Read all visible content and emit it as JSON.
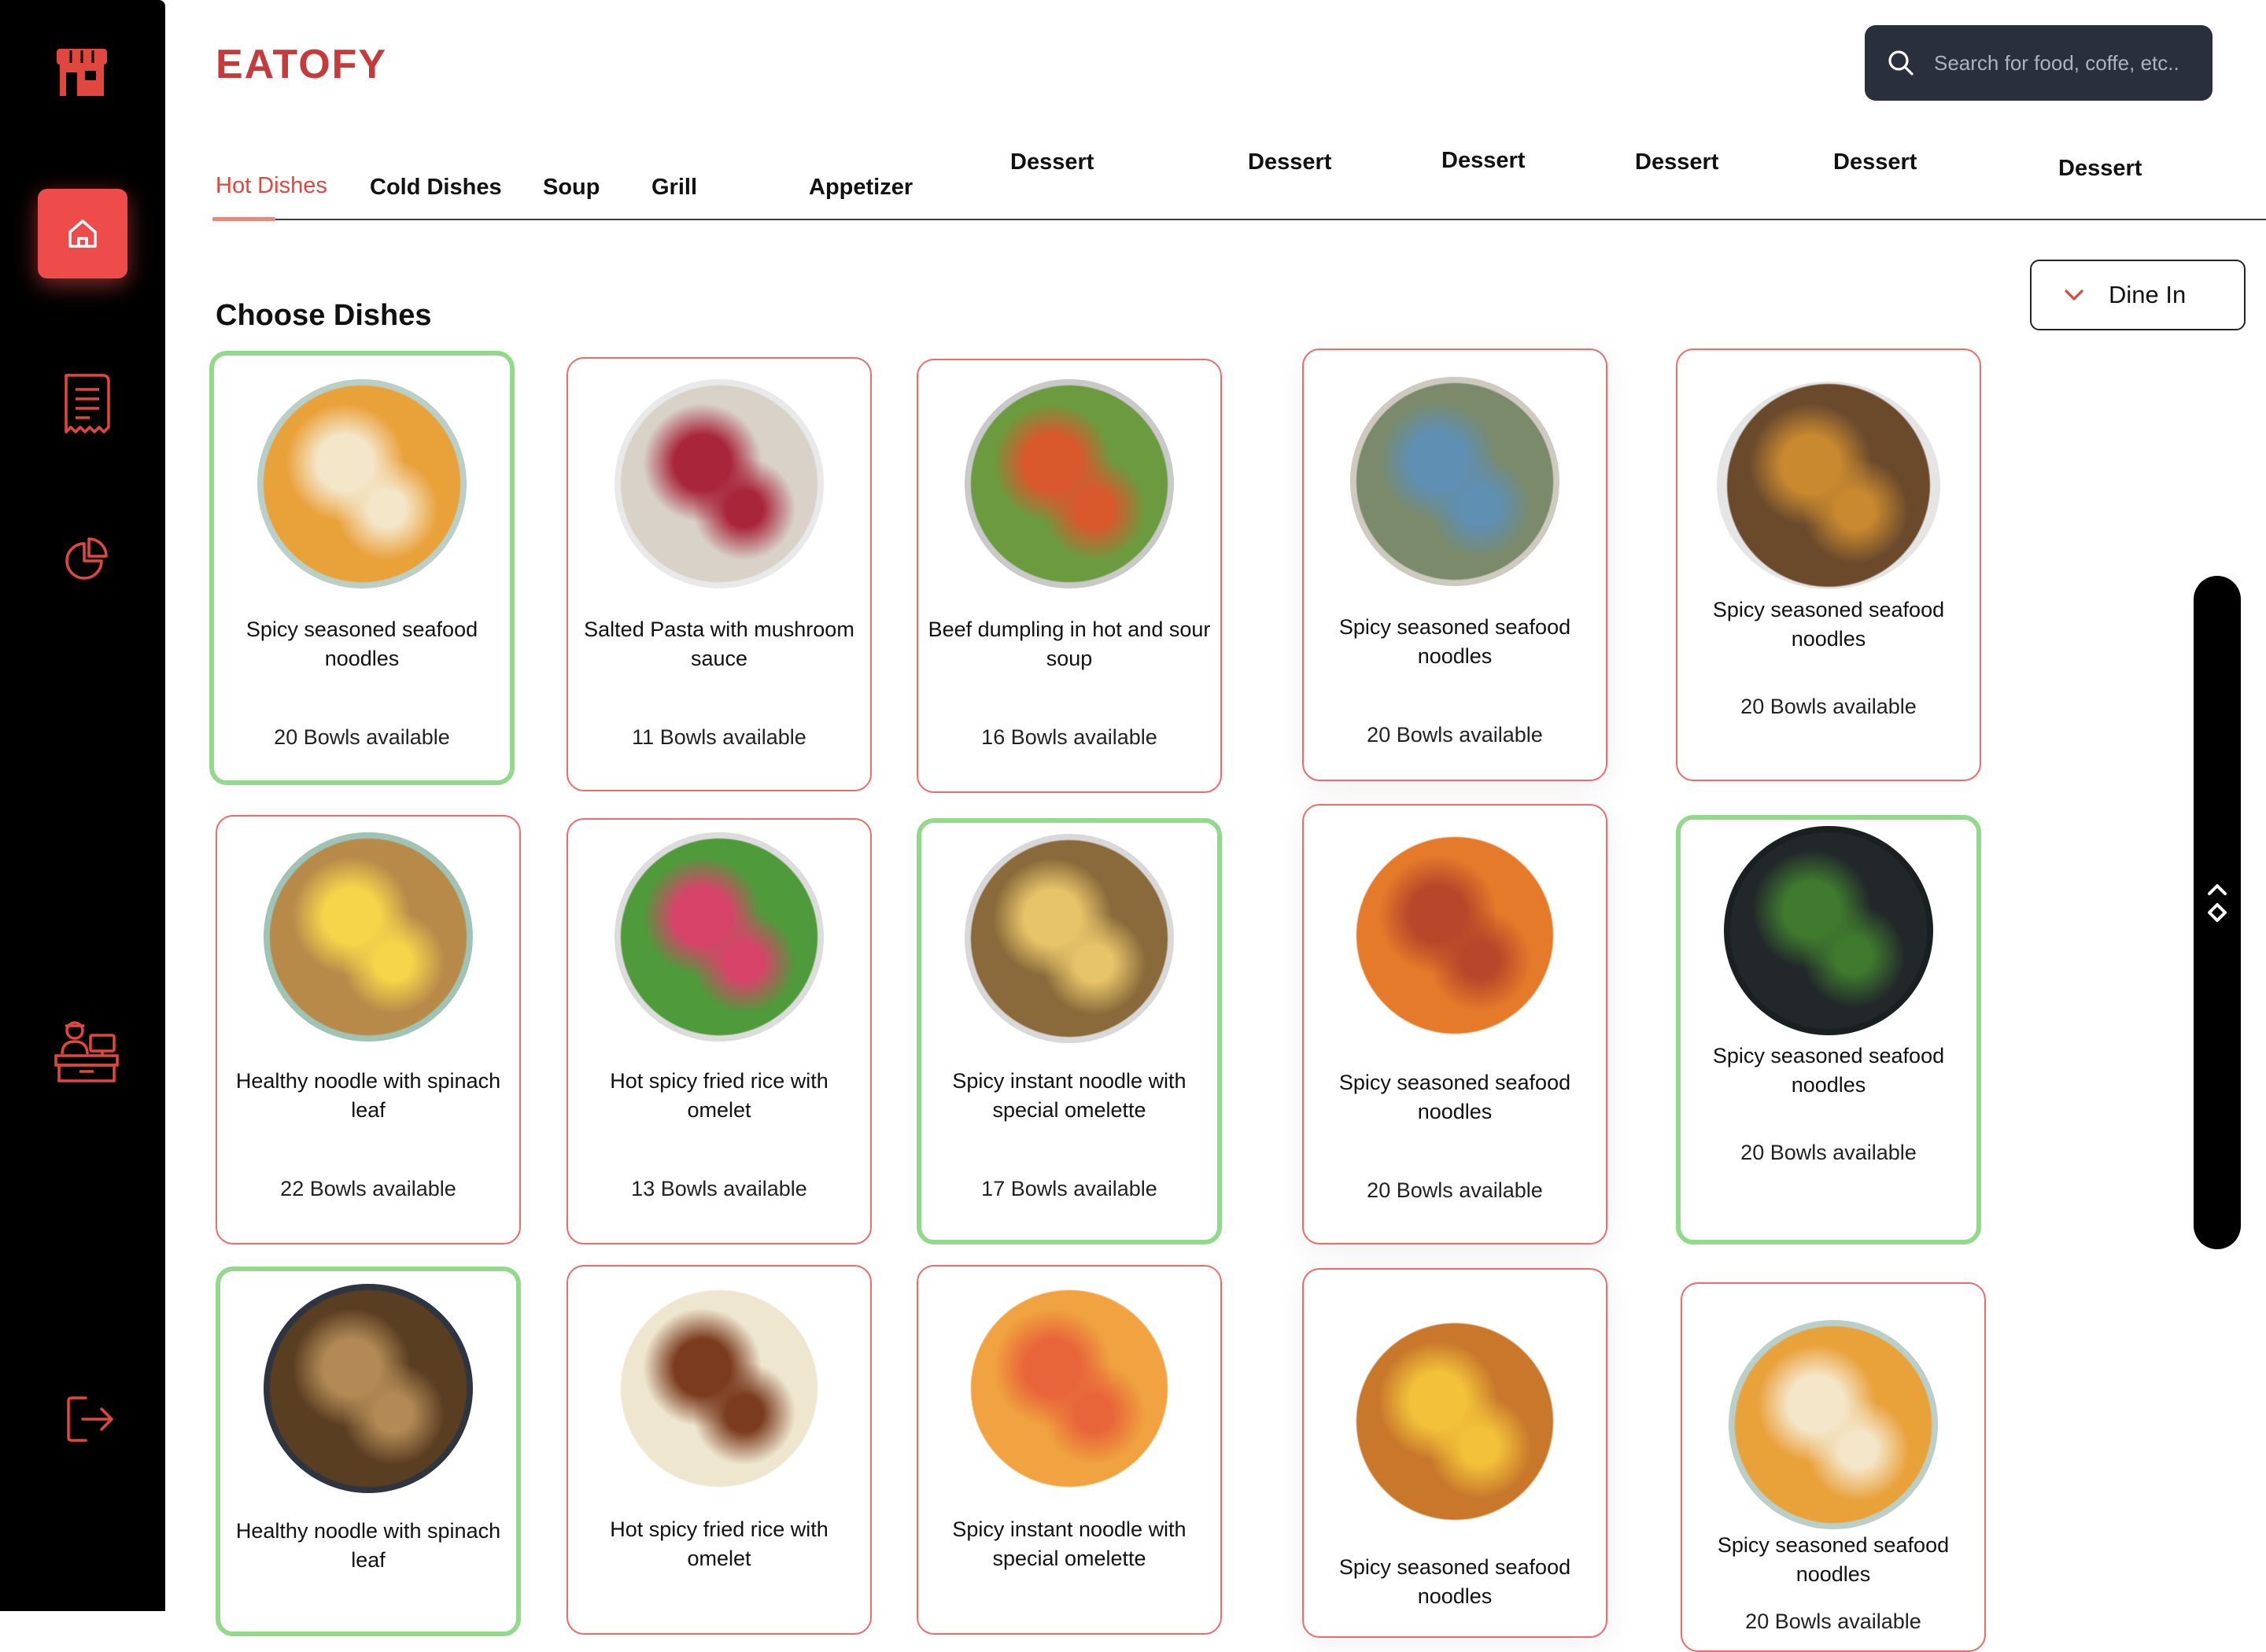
{
  "app": {
    "brand": "EATOFY"
  },
  "search": {
    "placeholder": "Search for food, coffe, etc.."
  },
  "tabs": [
    {
      "label": "Hot Dishes",
      "active": true
    },
    {
      "label": "Cold Dishes"
    },
    {
      "label": "Soup"
    },
    {
      "label": "Grill"
    },
    {
      "label": "Appetizer"
    },
    {
      "label": "Dessert"
    },
    {
      "label": "Dessert"
    },
    {
      "label": "Dessert"
    },
    {
      "label": "Dessert"
    },
    {
      "label": "Dessert"
    },
    {
      "label": "Dessert"
    }
  ],
  "order_type": {
    "selected": "Dine In"
  },
  "section": {
    "title": "Choose Dishes"
  },
  "sidebar": {
    "items": [
      {
        "icon": "store-icon"
      },
      {
        "icon": "home-icon",
        "active": true
      },
      {
        "icon": "receipt-icon"
      },
      {
        "icon": "pie-chart-icon"
      },
      {
        "icon": "cashier-icon"
      },
      {
        "icon": "logout-icon"
      }
    ]
  },
  "dishes": [
    {
      "name": "Spicy seasoned seafood noodles",
      "available": "20 Bowls available",
      "selected": true,
      "bg": "#e9a13a",
      "fg": "#f4e6c8",
      "rim": "#b9cfc7"
    },
    {
      "name": "Salted Pasta with mushroom sauce",
      "available": "11 Bowls available",
      "selected": false,
      "bg": "#d8d2c8",
      "fg": "#a8253a",
      "rim": "#e9e9e9"
    },
    {
      "name": "Beef dumpling in hot and sour soup",
      "available": "16 Bowls available",
      "selected": false,
      "bg": "#6c9a3f",
      "fg": "#d9582c",
      "rim": "#c9c9c9"
    },
    {
      "name": "Spicy seasoned seafood noodles",
      "available": "20 Bowls available",
      "selected": false,
      "bg": "#7a8a6a",
      "fg": "#5f8fb3",
      "rim": "#cfcac0"
    },
    {
      "name": "Spicy seasoned seafood noodles",
      "available": "20 Bowls available",
      "selected": false,
      "bg": "#6b4a2c",
      "fg": "#c9892f",
      "rim": "#e5e5e5"
    },
    {
      "name": "Healthy noodle with spinach leaf",
      "available": "22 Bowls available",
      "selected": false,
      "bg": "#b88a4a",
      "fg": "#f6d54a",
      "rim": "#9fc3b4"
    },
    {
      "name": "Hot spicy fried rice with omelet",
      "available": "13 Bowls available",
      "selected": false,
      "bg": "#4f9a3a",
      "fg": "#d8436a",
      "rim": "#dcdcdc"
    },
    {
      "name": "Spicy instant noodle with special omelette",
      "available": "17 Bowls available",
      "selected": true,
      "bg": "#8a6a3a",
      "fg": "#e7c46a",
      "rim": "#d8d8d8"
    },
    {
      "name": "Spicy seasoned seafood noodles",
      "available": "20 Bowls available",
      "selected": false,
      "bg": "#e57a2a",
      "fg": "#b8462a",
      "rim": "#ffffff"
    },
    {
      "name": "Spicy seasoned seafood noodles",
      "available": "20 Bowls available",
      "selected": true,
      "bg": "#22282a",
      "fg": "#3f7a2e",
      "rim": "#1a1f22"
    },
    {
      "name": "Healthy noodle with spinach leaf",
      "available": "",
      "selected": true,
      "bg": "#5a3e22",
      "fg": "#b38a55",
      "rim": "#2e3540"
    },
    {
      "name": "Hot spicy fried rice with omelet",
      "available": "",
      "selected": false,
      "bg": "#efe6cf",
      "fg": "#7a3b1e",
      "rim": "#ffffff"
    },
    {
      "name": "Spicy instant noodle with special omelette",
      "available": "",
      "selected": false,
      "bg": "#f0a340",
      "fg": "#e8653a",
      "rim": "#ffffff"
    },
    {
      "name": "Spicy seasoned seafood noodles",
      "available": "",
      "selected": false,
      "bg": "#c9782b",
      "fg": "#f3c23a",
      "rim": "#ffffff"
    },
    {
      "name": "Spicy seasoned seafood noodles",
      "available": "20 Bowls available",
      "selected": false,
      "bg": "#e9a13a",
      "fg": "#f4e6c8",
      "rim": "#b9cfc7"
    }
  ]
}
